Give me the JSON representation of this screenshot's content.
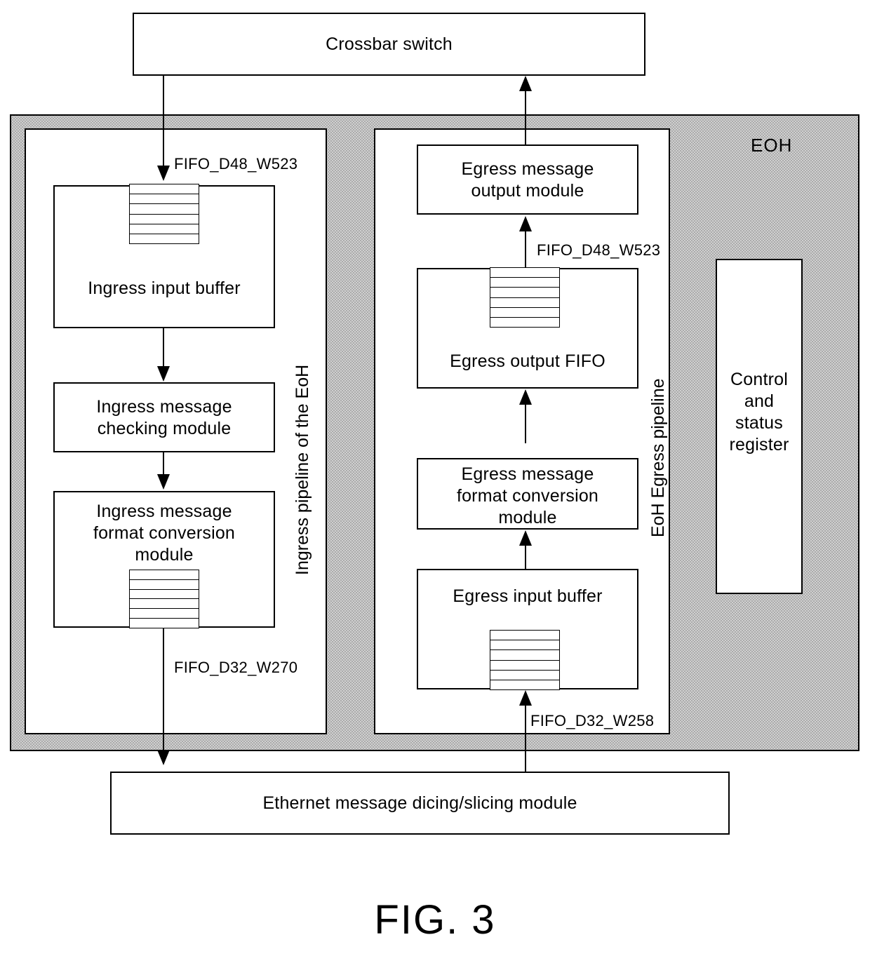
{
  "figure": {
    "caption": "FIG. 3",
    "eoh_label": "EOH"
  },
  "blocks": {
    "crossbar_switch": "Crossbar switch",
    "ethernet_dicing": "Ethernet message dicing/slicing module",
    "ingress_input_buffer": "Ingress input buffer",
    "ingress_checking": "Ingress message\ncheckingmodule",
    "ingress_checking_text": "Ingress message\nchecking module",
    "ingress_format_conversion": "Ingress message\nformat conversion\nmodule",
    "egress_output_module": "Egress message\noutput module",
    "egress_output_fifo": "Egress output FIFO",
    "egress_format_conversion": "Egress message\nformat conversion\nmodule",
    "egress_input_buffer": "Egress input buffer",
    "control_status_register": "Control\nand\nstatus\nregister"
  },
  "pipelines": {
    "ingress_label": "Ingress pipeline of the EoH",
    "egress_label": "EoH Egress pipeline"
  },
  "fifo_tags": {
    "ingress_in": "FIFO_D48_W523",
    "ingress_out": "FIFO_D32_W270",
    "egress_out": "FIFO_D48_W523",
    "egress_in": "FIFO_D32_W258"
  },
  "colors": {
    "line": "#000000",
    "eoh_fill": "#d0d0d0",
    "box_fill": "#ffffff"
  }
}
